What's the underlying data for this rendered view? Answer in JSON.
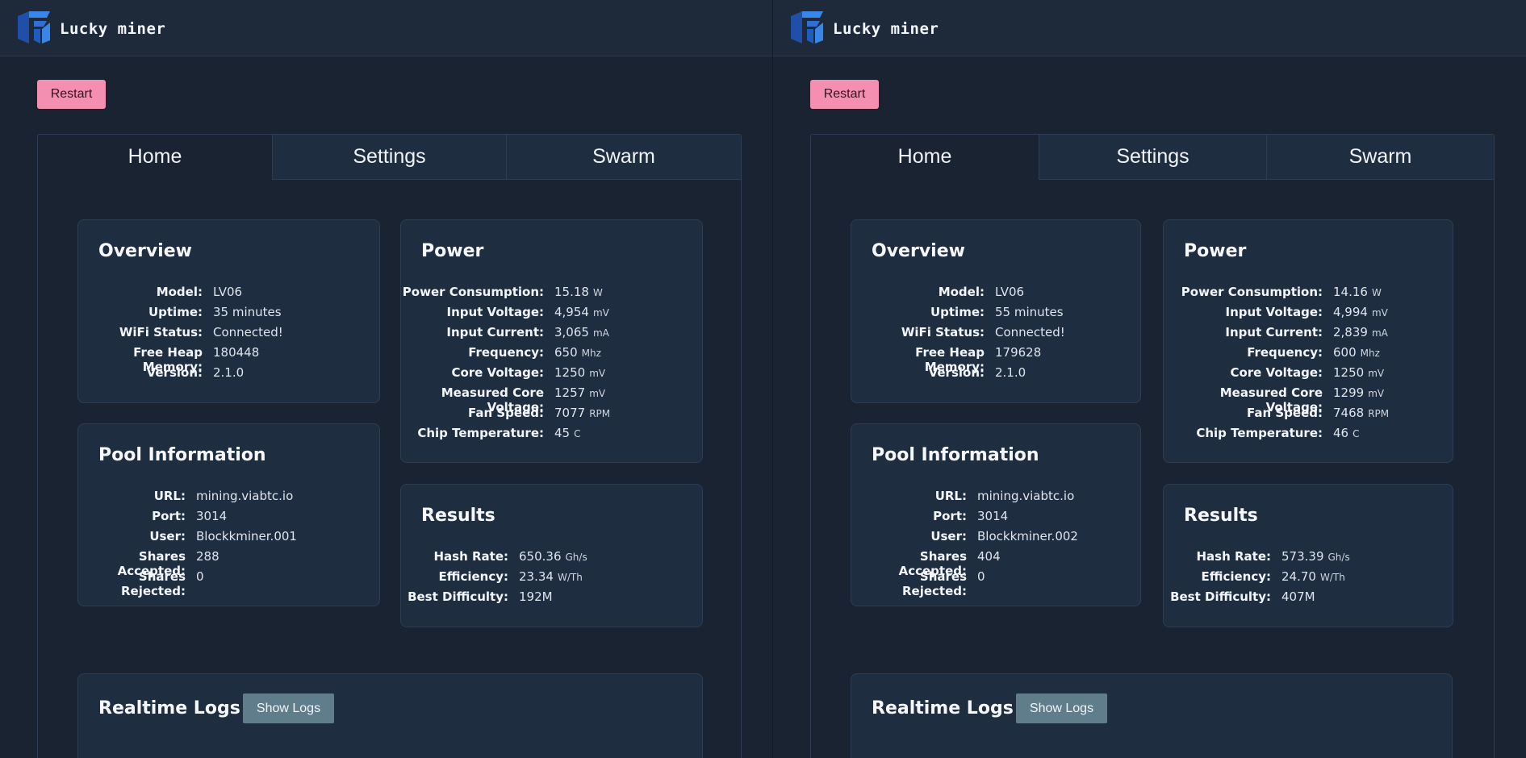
{
  "brand": {
    "name": "Lucky miner"
  },
  "colors": {
    "background": "#1a2332",
    "card": "#1f2d40",
    "restart": "#f48fb1",
    "show_logs": "#607d8b",
    "logo_blue": "#2f6fd6"
  },
  "tab_labels": [
    "Home",
    "Settings",
    "Swarm"
  ],
  "active_tab": "Home",
  "restart_label": "Restart",
  "show_logs_label": "Show Logs",
  "icons": {
    "logo": "lucky-miner-logo-icon"
  },
  "miners": [
    {
      "overview": {
        "title": "Overview",
        "rows": [
          {
            "label": "Model:",
            "value": "LV06"
          },
          {
            "label": "Uptime:",
            "value": "35 minutes"
          },
          {
            "label": "WiFi Status:",
            "value": "Connected!"
          },
          {
            "label": "Free Heap Memory:",
            "value": "180448"
          },
          {
            "label": "Version:",
            "value": "2.1.0"
          }
        ]
      },
      "pool": {
        "title": "Pool Information",
        "rows": [
          {
            "label": "URL:",
            "value": "mining.viabtc.io"
          },
          {
            "label": "Port:",
            "value": "3014"
          },
          {
            "label": "User:",
            "value": "Blockkminer.001"
          },
          {
            "label": "Shares Accepted:",
            "value": "288"
          },
          {
            "label": "Shares Rejected:",
            "value": "0"
          }
        ]
      },
      "power": {
        "title": "Power",
        "rows": [
          {
            "label": "Power Consumption:",
            "value": "15.18",
            "unit": "W"
          },
          {
            "label": "Input Voltage:",
            "value": "4,954",
            "unit": "mV"
          },
          {
            "label": "Input Current:",
            "value": "3,065",
            "unit": "mA"
          },
          {
            "label": "Frequency:",
            "value": "650",
            "unit": "Mhz"
          },
          {
            "label": "Core Voltage:",
            "value": "1250",
            "unit": "mV"
          },
          {
            "label": "Measured Core Voltage:",
            "value": "1257",
            "unit": "mV"
          },
          {
            "label": "Fan Speed:",
            "value": "7077",
            "unit": "RPM"
          },
          {
            "label": "Chip Temperature:",
            "value": "45",
            "unit": "C"
          }
        ]
      },
      "results": {
        "title": "Results",
        "rows": [
          {
            "label": "Hash Rate:",
            "value": "650.36",
            "unit": "Gh/s"
          },
          {
            "label": "Efficiency:",
            "value": "23.34",
            "unit": "W/Th"
          },
          {
            "label": "Best Difficulty:",
            "value": "192M"
          }
        ]
      },
      "logs": {
        "title": "Realtime Logs"
      }
    },
    {
      "overview": {
        "title": "Overview",
        "rows": [
          {
            "label": "Model:",
            "value": "LV06"
          },
          {
            "label": "Uptime:",
            "value": "55 minutes"
          },
          {
            "label": "WiFi Status:",
            "value": "Connected!"
          },
          {
            "label": "Free Heap Memory:",
            "value": "179628"
          },
          {
            "label": "Version:",
            "value": "2.1.0"
          }
        ]
      },
      "pool": {
        "title": "Pool Information",
        "rows": [
          {
            "label": "URL:",
            "value": "mining.viabtc.io"
          },
          {
            "label": "Port:",
            "value": "3014"
          },
          {
            "label": "User:",
            "value": "Blockkminer.002"
          },
          {
            "label": "Shares Accepted:",
            "value": "404"
          },
          {
            "label": "Shares Rejected:",
            "value": "0"
          }
        ]
      },
      "power": {
        "title": "Power",
        "rows": [
          {
            "label": "Power Consumption:",
            "value": "14.16",
            "unit": "W"
          },
          {
            "label": "Input Voltage:",
            "value": "4,994",
            "unit": "mV"
          },
          {
            "label": "Input Current:",
            "value": "2,839",
            "unit": "mA"
          },
          {
            "label": "Frequency:",
            "value": "600",
            "unit": "Mhz"
          },
          {
            "label": "Core Voltage:",
            "value": "1250",
            "unit": "mV"
          },
          {
            "label": "Measured Core Voltage:",
            "value": "1299",
            "unit": "mV"
          },
          {
            "label": "Fan Speed:",
            "value": "7468",
            "unit": "RPM"
          },
          {
            "label": "Chip Temperature:",
            "value": "46",
            "unit": "C"
          }
        ]
      },
      "results": {
        "title": "Results",
        "rows": [
          {
            "label": "Hash Rate:",
            "value": "573.39",
            "unit": "Gh/s"
          },
          {
            "label": "Efficiency:",
            "value": "24.70",
            "unit": "W/Th"
          },
          {
            "label": "Best Difficulty:",
            "value": "407M"
          }
        ]
      },
      "logs": {
        "title": "Realtime Logs"
      }
    }
  ]
}
